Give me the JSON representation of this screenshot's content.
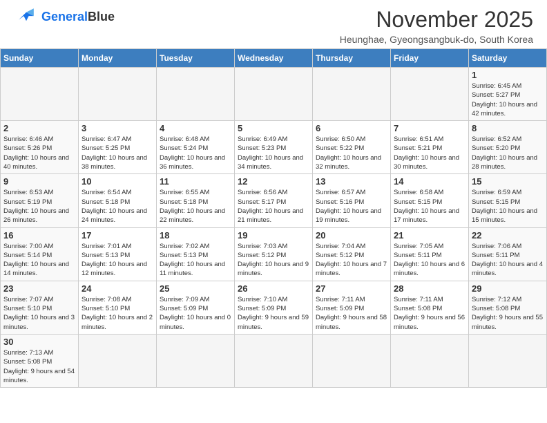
{
  "header": {
    "logo_general": "General",
    "logo_blue": "Blue",
    "month_title": "November 2025",
    "location": "Heunghae, Gyeongsangbuk-do, South Korea"
  },
  "weekdays": [
    "Sunday",
    "Monday",
    "Tuesday",
    "Wednesday",
    "Thursday",
    "Friday",
    "Saturday"
  ],
  "days": {
    "1": {
      "sunrise": "6:45 AM",
      "sunset": "5:27 PM",
      "daylight": "10 hours and 42 minutes."
    },
    "2": {
      "sunrise": "6:46 AM",
      "sunset": "5:26 PM",
      "daylight": "10 hours and 40 minutes."
    },
    "3": {
      "sunrise": "6:47 AM",
      "sunset": "5:25 PM",
      "daylight": "10 hours and 38 minutes."
    },
    "4": {
      "sunrise": "6:48 AM",
      "sunset": "5:24 PM",
      "daylight": "10 hours and 36 minutes."
    },
    "5": {
      "sunrise": "6:49 AM",
      "sunset": "5:23 PM",
      "daylight": "10 hours and 34 minutes."
    },
    "6": {
      "sunrise": "6:50 AM",
      "sunset": "5:22 PM",
      "daylight": "10 hours and 32 minutes."
    },
    "7": {
      "sunrise": "6:51 AM",
      "sunset": "5:21 PM",
      "daylight": "10 hours and 30 minutes."
    },
    "8": {
      "sunrise": "6:52 AM",
      "sunset": "5:20 PM",
      "daylight": "10 hours and 28 minutes."
    },
    "9": {
      "sunrise": "6:53 AM",
      "sunset": "5:19 PM",
      "daylight": "10 hours and 26 minutes."
    },
    "10": {
      "sunrise": "6:54 AM",
      "sunset": "5:18 PM",
      "daylight": "10 hours and 24 minutes."
    },
    "11": {
      "sunrise": "6:55 AM",
      "sunset": "5:18 PM",
      "daylight": "10 hours and 22 minutes."
    },
    "12": {
      "sunrise": "6:56 AM",
      "sunset": "5:17 PM",
      "daylight": "10 hours and 21 minutes."
    },
    "13": {
      "sunrise": "6:57 AM",
      "sunset": "5:16 PM",
      "daylight": "10 hours and 19 minutes."
    },
    "14": {
      "sunrise": "6:58 AM",
      "sunset": "5:15 PM",
      "daylight": "10 hours and 17 minutes."
    },
    "15": {
      "sunrise": "6:59 AM",
      "sunset": "5:15 PM",
      "daylight": "10 hours and 15 minutes."
    },
    "16": {
      "sunrise": "7:00 AM",
      "sunset": "5:14 PM",
      "daylight": "10 hours and 14 minutes."
    },
    "17": {
      "sunrise": "7:01 AM",
      "sunset": "5:13 PM",
      "daylight": "10 hours and 12 minutes."
    },
    "18": {
      "sunrise": "7:02 AM",
      "sunset": "5:13 PM",
      "daylight": "10 hours and 11 minutes."
    },
    "19": {
      "sunrise": "7:03 AM",
      "sunset": "5:12 PM",
      "daylight": "10 hours and 9 minutes."
    },
    "20": {
      "sunrise": "7:04 AM",
      "sunset": "5:12 PM",
      "daylight": "10 hours and 7 minutes."
    },
    "21": {
      "sunrise": "7:05 AM",
      "sunset": "5:11 PM",
      "daylight": "10 hours and 6 minutes."
    },
    "22": {
      "sunrise": "7:06 AM",
      "sunset": "5:11 PM",
      "daylight": "10 hours and 4 minutes."
    },
    "23": {
      "sunrise": "7:07 AM",
      "sunset": "5:10 PM",
      "daylight": "10 hours and 3 minutes."
    },
    "24": {
      "sunrise": "7:08 AM",
      "sunset": "5:10 PM",
      "daylight": "10 hours and 2 minutes."
    },
    "25": {
      "sunrise": "7:09 AM",
      "sunset": "5:09 PM",
      "daylight": "10 hours and 0 minutes."
    },
    "26": {
      "sunrise": "7:10 AM",
      "sunset": "5:09 PM",
      "daylight": "9 hours and 59 minutes."
    },
    "27": {
      "sunrise": "7:11 AM",
      "sunset": "5:09 PM",
      "daylight": "9 hours and 58 minutes."
    },
    "28": {
      "sunrise": "7:11 AM",
      "sunset": "5:08 PM",
      "daylight": "9 hours and 56 minutes."
    },
    "29": {
      "sunrise": "7:12 AM",
      "sunset": "5:08 PM",
      "daylight": "9 hours and 55 minutes."
    },
    "30": {
      "sunrise": "7:13 AM",
      "sunset": "5:08 PM",
      "daylight": "9 hours and 54 minutes."
    }
  }
}
